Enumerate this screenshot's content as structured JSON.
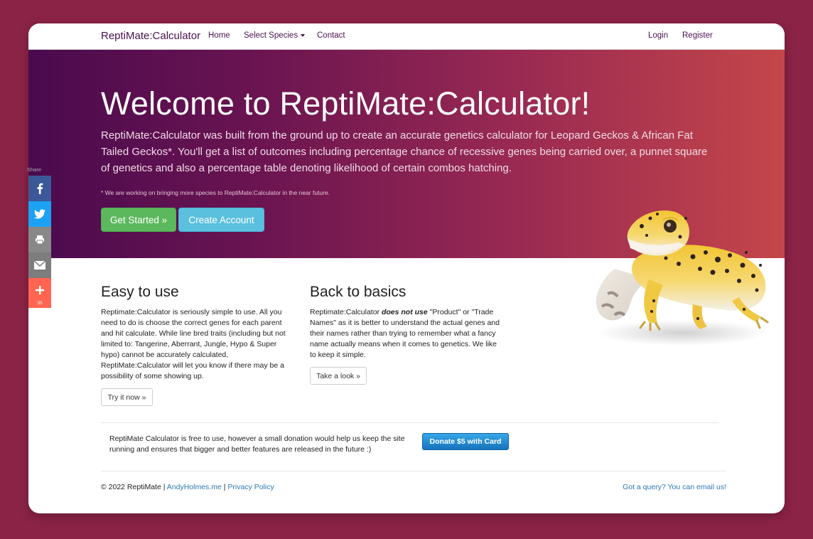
{
  "navbar": {
    "brand": "ReptiMate:Calculator",
    "home": "Home",
    "species": "Select Species",
    "contact": "Contact",
    "login": "Login",
    "register": "Register"
  },
  "hero": {
    "title": "Welcome to ReptiMate:Calculator!",
    "lead": "ReptiMate:Calculator was built from the ground up to create an accurate genetics calculator for Leopard Geckos & African Fat Tailed Geckos*. You'll get a list of outcomes including percentage chance of recessive genes being carried over, a punnet square of genetics and also a percentage table denoting likelihood of certain combos hatching.",
    "note": "* We are working on bringing more species to ReptiMate:Calculator in the near future.",
    "get_started": "Get Started »",
    "create_account": "Create Account"
  },
  "easy": {
    "heading": "Easy to use",
    "body": "Reptimate:Calculator is seriously simple to use. All you need to do is choose the correct genes for each parent and hit calculate. While line bred traits (including but not limited to: Tangerine, Aberrant, Jungle, Hypo & Super hypo) cannot be accurately calculated, ReptiMate:Calculator will let you know if there may be a possibility of some showing up.",
    "button": "Try it now »"
  },
  "basics": {
    "heading": "Back to basics",
    "body_start": "Reptimate:Calculator ",
    "body_emph": "does not use",
    "body_end": " \"Product\" or \"Trade Names\" as it is better to understand the actual genes and their names rather than trying to remember what a fancy name actually means when it comes to genetics. We like to keep it simple.",
    "button": "Take a look »"
  },
  "donate": {
    "text": "ReptiMate Calculator is free to use, however a small donation would help us keep the site running and ensures that bigger and better features are released in the future :)",
    "button": "Donate $5 with Card"
  },
  "footer": {
    "copyright": "© 2022 ReptiMate | ",
    "link1": "AndyHolmes.me",
    "sep": " | ",
    "link2": "Privacy Policy",
    "contact": "Got a query? You can email us!"
  },
  "share": {
    "label": "Share",
    "count": "35",
    "items": [
      {
        "name": "facebook",
        "icon": "facebook-icon",
        "color": "#3b5998"
      },
      {
        "name": "twitter",
        "icon": "twitter-icon",
        "color": "#1da1f2"
      },
      {
        "name": "print",
        "icon": "print-icon",
        "color": "#888888"
      },
      {
        "name": "email",
        "icon": "email-icon",
        "color": "#7d7d7d"
      },
      {
        "name": "more",
        "icon": "plus-icon",
        "color": "#ff6550"
      }
    ]
  }
}
